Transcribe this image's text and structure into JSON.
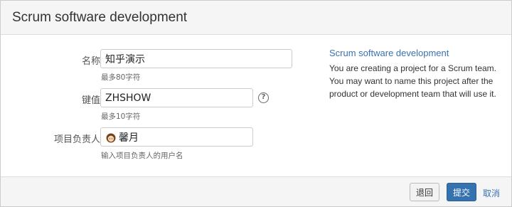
{
  "dialog": {
    "title": "Scrum software development"
  },
  "form": {
    "name": {
      "label": "名称",
      "value": "知乎演示",
      "hint": "最多80字符"
    },
    "key": {
      "label": "键值",
      "value": "ZHSHOW",
      "hint": "最多10字符",
      "help_icon": "question-circle-icon"
    },
    "lead": {
      "label": "项目负责人",
      "value": "馨月",
      "avatar_icon": "user-avatar-icon",
      "hint": "输入项目负责人的用户名"
    }
  },
  "sidebar": {
    "title": "Scrum software development",
    "description": "You are creating a project for a Scrum team. You may want to name this project after the product or development team that will use it."
  },
  "footer": {
    "back_label": "退回",
    "submit_label": "提交",
    "cancel_label": "取消"
  },
  "colors": {
    "primary": "#3572b0",
    "link": "#3b73af",
    "header_bg": "#f5f5f5"
  }
}
